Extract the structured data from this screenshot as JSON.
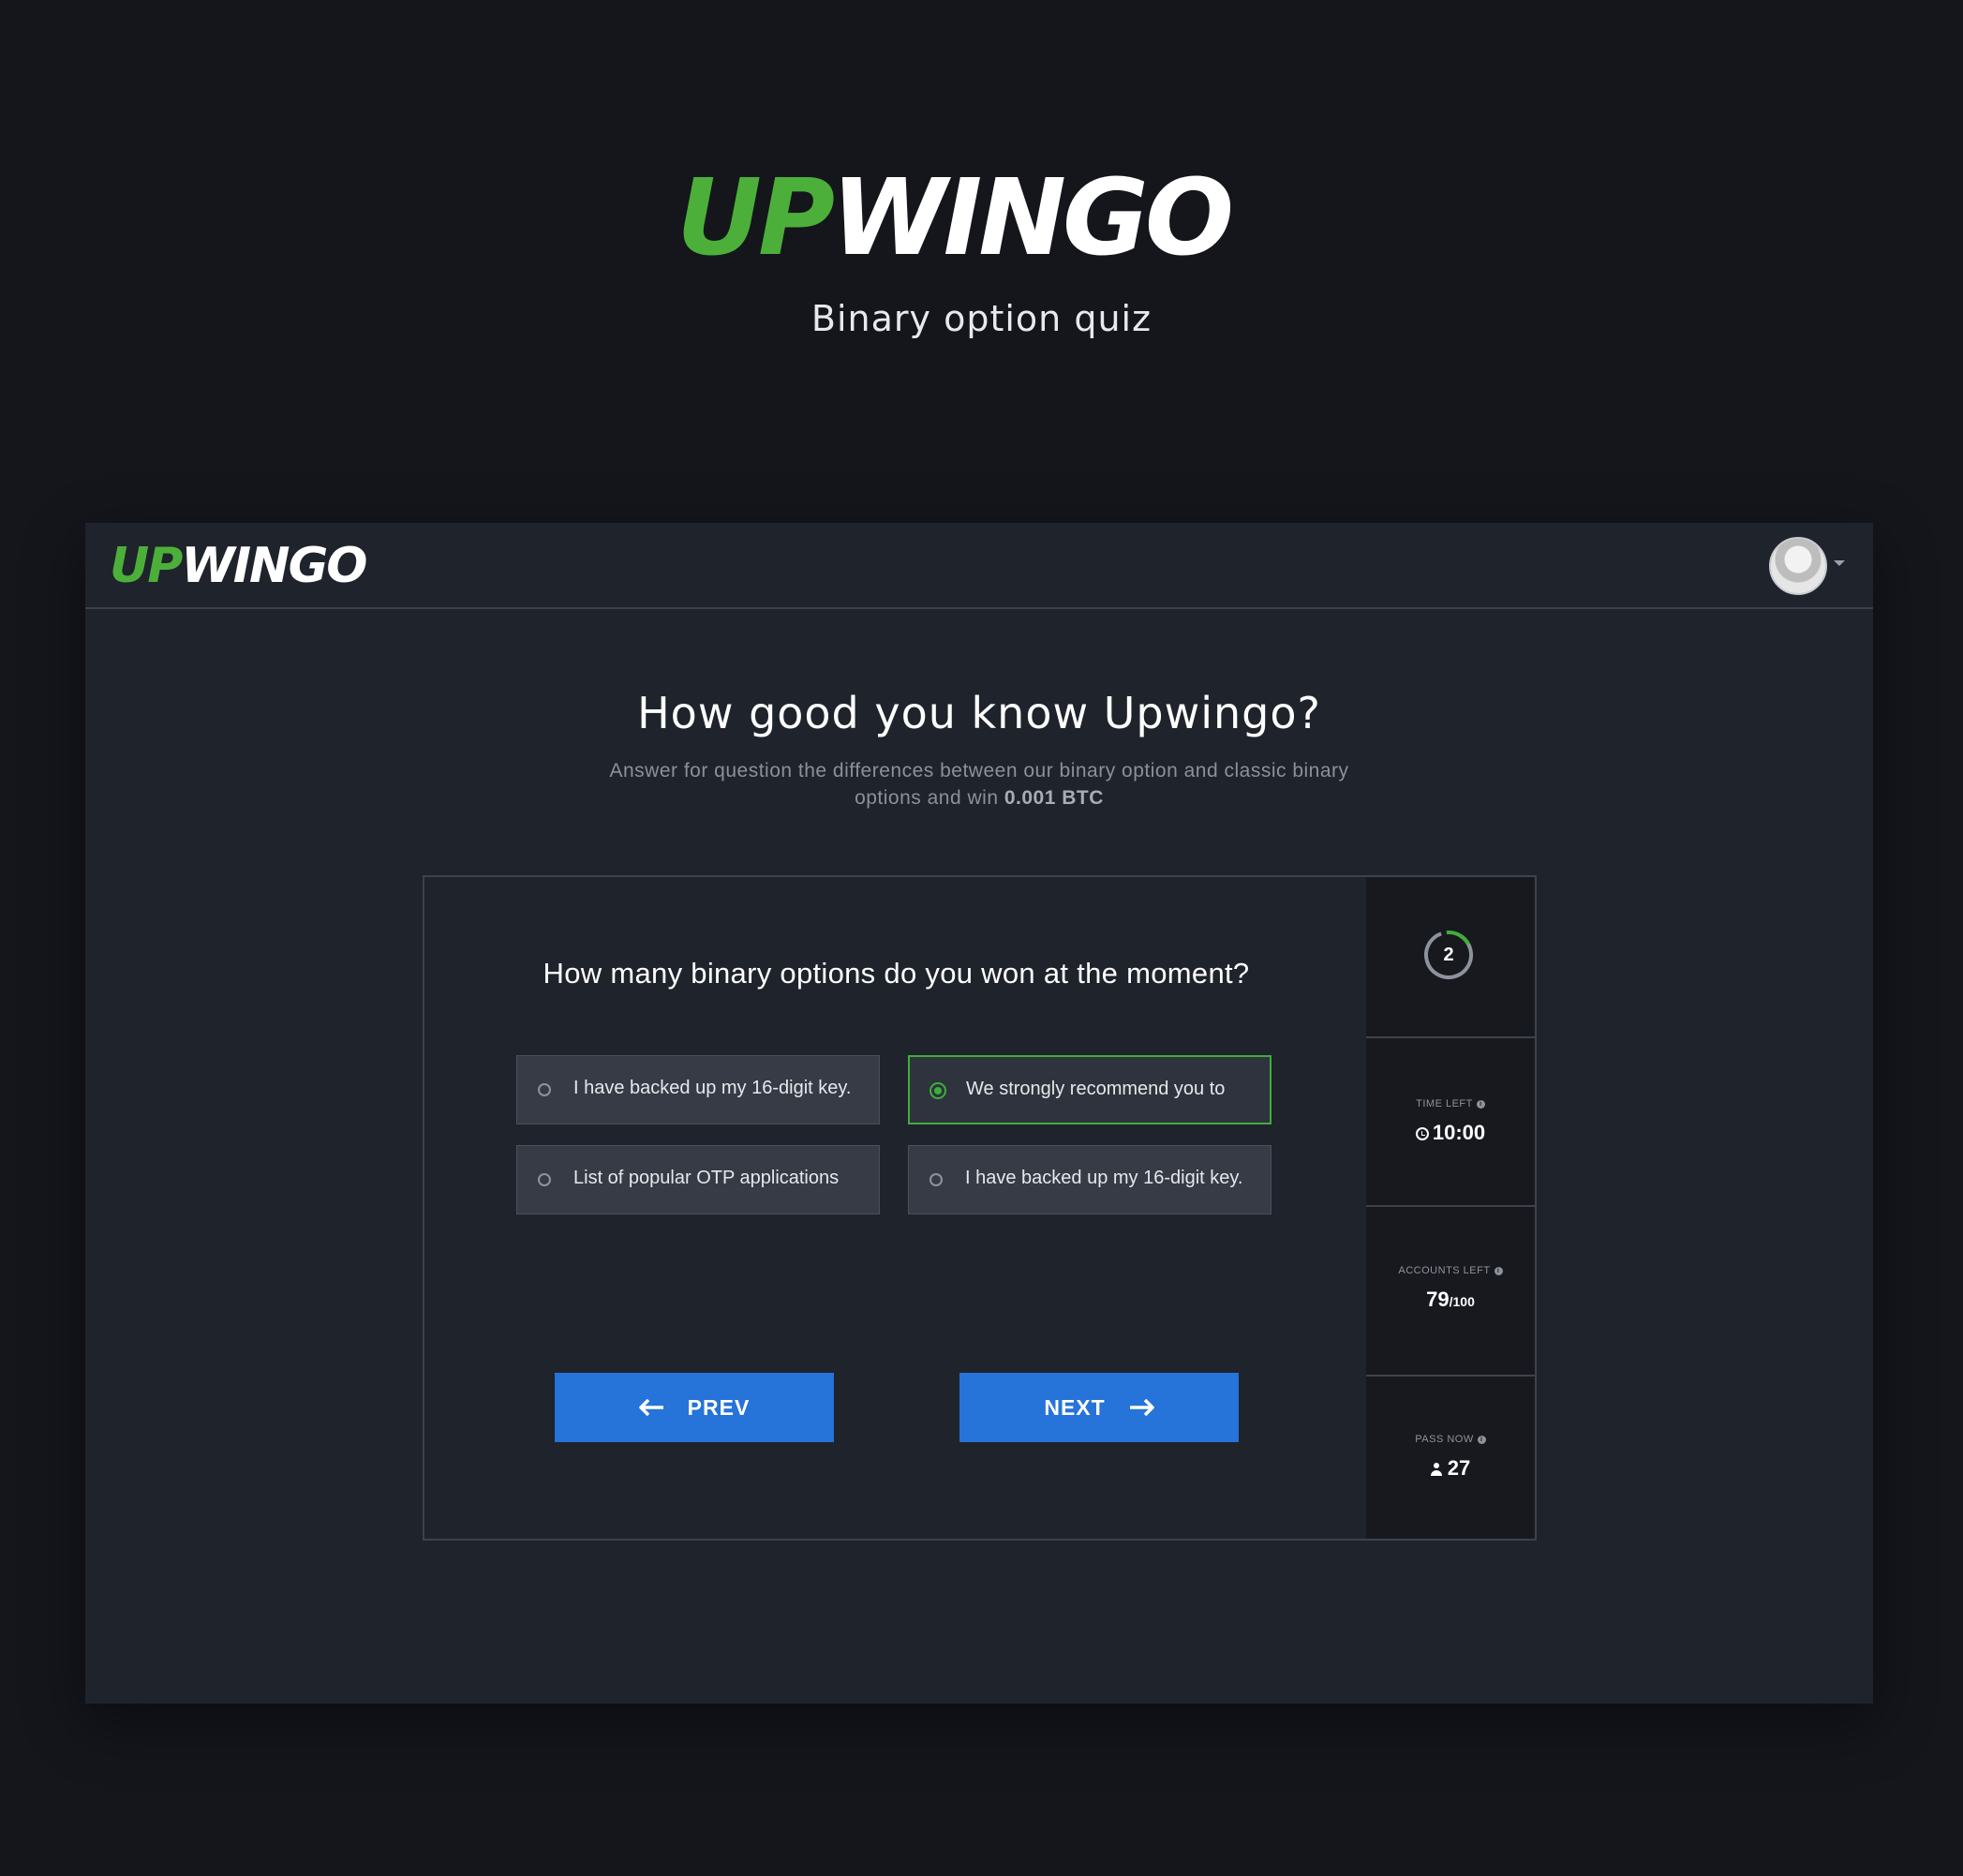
{
  "hero": {
    "logo_up": "UP",
    "logo_wingo": "WINGO",
    "subtitle": "Binary option quiz"
  },
  "header": {
    "logo_up": "UP",
    "logo_wingo": "WINGO"
  },
  "quiz": {
    "title": "How good you know Upwingo?",
    "description_line": "Answer for question the differences between our binary option and classic binary options and win",
    "prize": "0.001 BTC",
    "question": "How many binary options do you won at the moment?",
    "options": [
      {
        "label": "I have backed up my 16-digit key.",
        "selected": false
      },
      {
        "label": "We strongly recommend you to",
        "selected": true
      },
      {
        "label": "List of popular OTP applications",
        "selected": false
      },
      {
        "label": "I have backed up my 16-digit key.",
        "selected": false
      }
    ],
    "prev_label": "PREV",
    "next_label": "NEXT"
  },
  "stats": {
    "step": "2",
    "time_left_label": "TIME LEFT",
    "time_left_value": "10:00",
    "accounts_left_label": "ACCOUNTS LEFT",
    "accounts_left_value": "79",
    "accounts_left_total": "/100",
    "pass_now_label": "PASS NOW",
    "pass_now_value": "27"
  },
  "colors": {
    "background": "#14161c",
    "panel": "#1f232c",
    "brand_green": "#4caf3a",
    "button_blue": "#2673d9"
  }
}
